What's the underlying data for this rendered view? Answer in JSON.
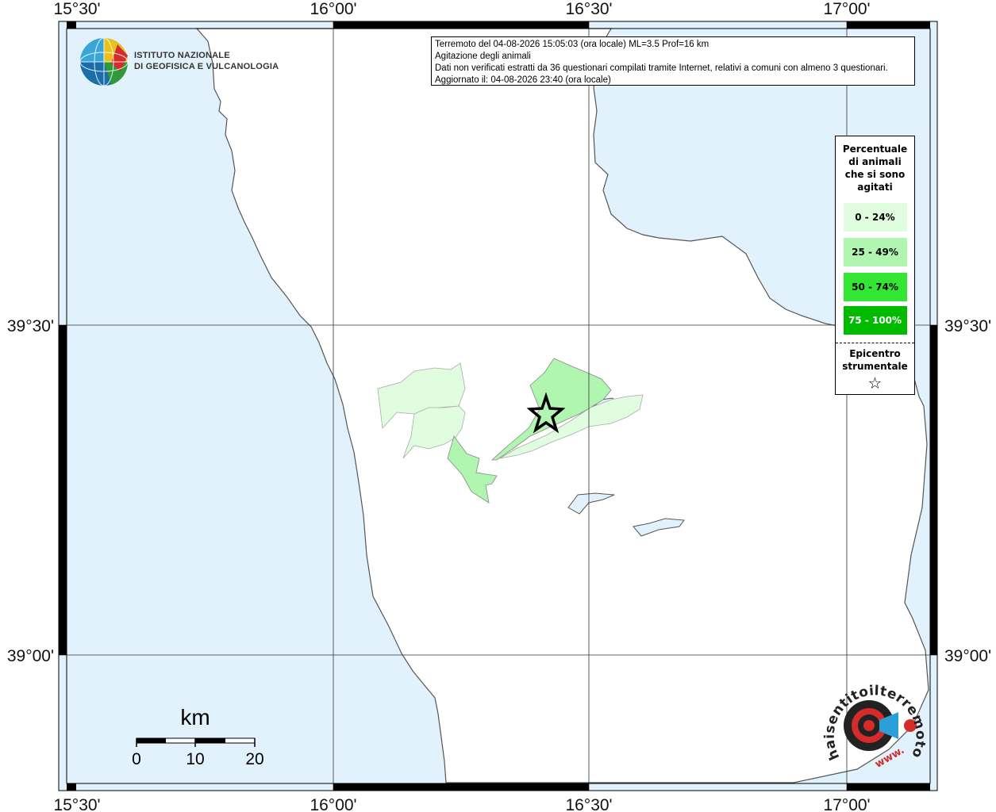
{
  "header": {
    "line1": "Terremoto del 04-08-2026 15:05:03 (ora locale) ML=3.5 Prof=16 km",
    "line2": "Agitazione degli animali",
    "line3": "Dati non verificati estratti da 36 questionari compilati tramite Internet, relativi a comuni con almeno 3 questionari.",
    "line4": "Aggiornato il: 04-08-2026 23:40 (ora locale)"
  },
  "institute": {
    "line1": "ISTITUTO NAZIONALE",
    "line2": "DI GEOFISICA E VULCANOLOGIA"
  },
  "axis": {
    "top_labels": [
      "15°30'",
      "16°00'",
      "16°30'",
      "17°00'"
    ],
    "bottom_labels": [
      "15°30'",
      "16°00'",
      "16°30'",
      "17°00'"
    ],
    "left_labels": [
      "39°30'",
      "39°00'"
    ],
    "right_labels": [
      "39°30'",
      "39°00'"
    ]
  },
  "legend": {
    "title_lines": [
      "Percentuale",
      "di animali",
      "che si sono",
      "agitati"
    ],
    "items": [
      {
        "label": "0 - 24%",
        "color": "#e0fde0",
        "text_color": "#000000"
      },
      {
        "label": "25 - 49%",
        "color": "#b0f5b0",
        "text_color": "#000000"
      },
      {
        "label": "50 - 74%",
        "color": "#33e633",
        "text_color": "#000000"
      },
      {
        "label": "75 - 100%",
        "color": "#00bb00",
        "text_color": "#ffffff"
      }
    ],
    "epicenter_lines": [
      "Epicentro",
      "strumentale"
    ],
    "epicenter_symbol": "☆"
  },
  "scale_bar": {
    "unit": "km",
    "labels": [
      "0",
      "10",
      "20"
    ]
  },
  "watermark": {
    "text": "haisentitoilterremoto.it",
    "prefix": "www."
  },
  "colors": {
    "sea": "#e1f2fd",
    "land": "#ffffff",
    "coast": "#555555",
    "grid": "#333333",
    "pct_0_24": "#e0fde0",
    "pct_25_49": "#b0f5b0"
  }
}
